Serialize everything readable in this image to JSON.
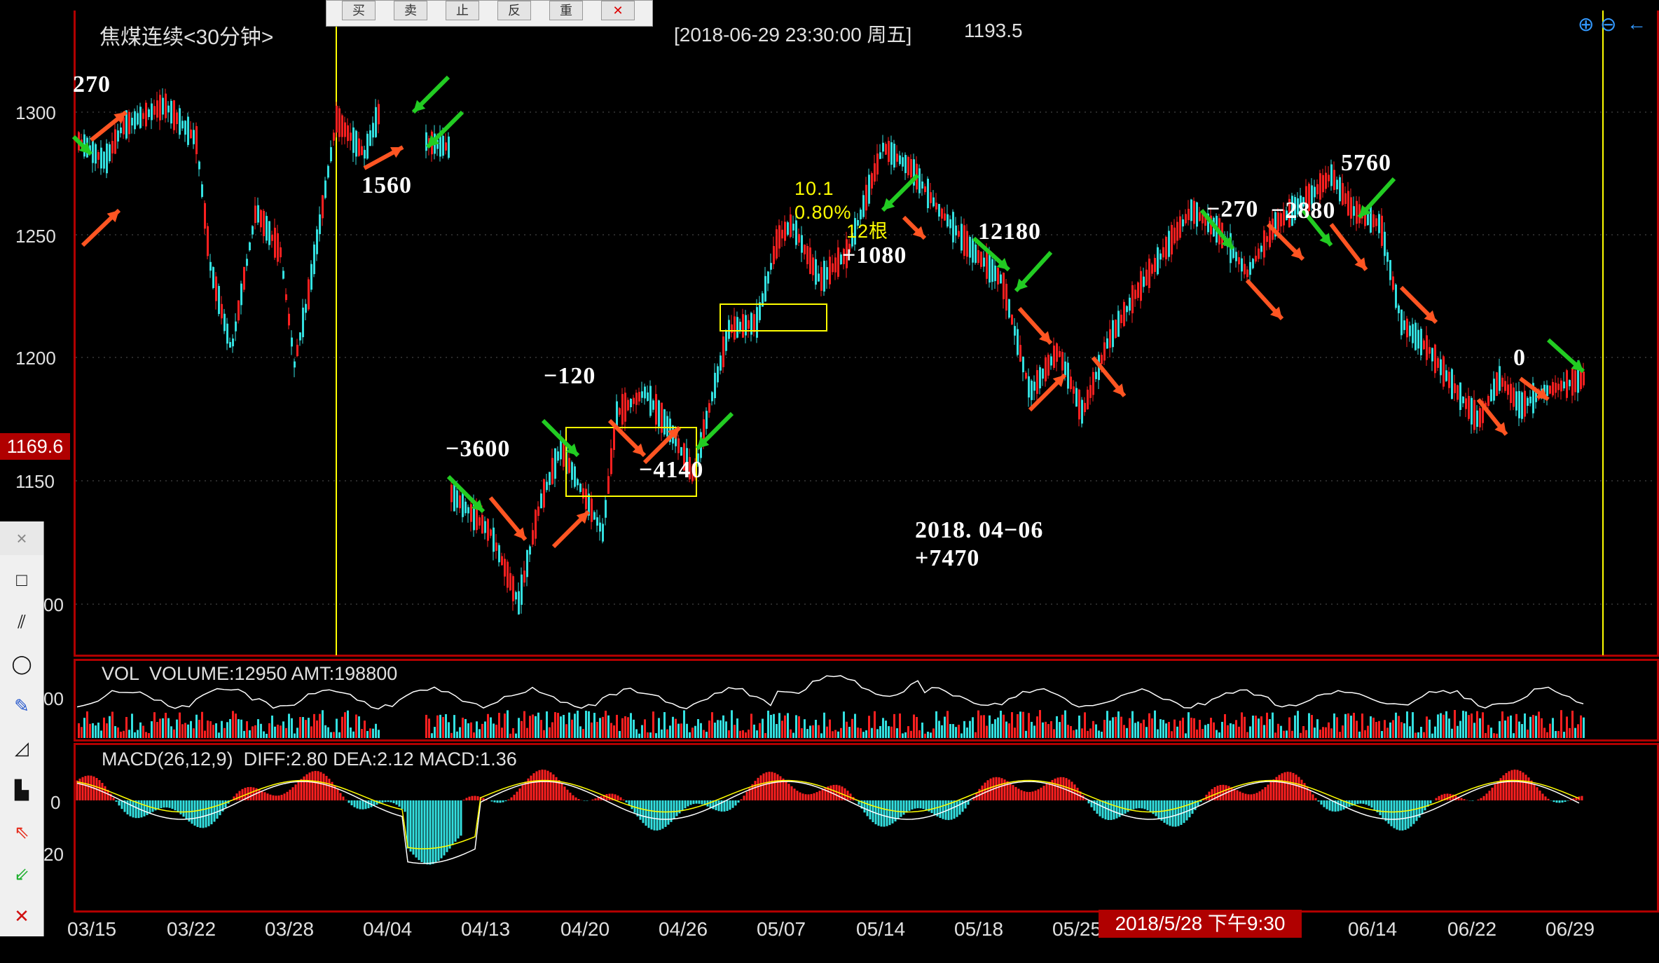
{
  "header": {
    "symbol_title": "焦煤连续<30分钟>",
    "crosshair_time": "[2018-06-29  23:30:00 周五]",
    "crosshair_price": "1193.5"
  },
  "toolbar": {
    "buttons": [
      "买",
      "卖",
      "止",
      "反",
      "重",
      "✕"
    ]
  },
  "draw_tools": {
    "close_label": "×",
    "items": [
      "rectangle-tool",
      "parallel-lines-tool",
      "ellipse-tool",
      "pen-tool",
      "gann-tool",
      "ruler-tool",
      "up-arrow-tool",
      "down-arrow-tool",
      "delete-tool"
    ]
  },
  "price_axis": {
    "ticks": [
      "1300",
      "1250",
      "1200",
      "1150",
      "00"
    ],
    "current_price_tag": "1169.6"
  },
  "vol_axis": {
    "tick": "00"
  },
  "macd_axis": {
    "ticks": [
      "0",
      "20"
    ]
  },
  "date_axis": [
    "03/15",
    "03/22",
    "03/28",
    "04/04",
    "04/13",
    "04/20",
    "04/26",
    "05/07",
    "05/14",
    "05/18",
    "05/25",
    "06/14",
    "06/22",
    "06/29"
  ],
  "crosshair_date": "2018/5/28 下午9:30",
  "indicators": {
    "vol": "VOL  VOLUME:12950 AMT:198800",
    "macd": "MACD(26,12,9)  DIFF:2.80 DEA:2.12 MACD:1.36"
  },
  "annotations": {
    "a270_left": "270",
    "a1560": "1560",
    "a_3600": "−3600",
    "a_120": "−120",
    "a_4140": "−4140",
    "yellow_101": "10.1",
    "yellow_080": "0.80%",
    "yellow_12": "12根",
    "a1080": "+1080",
    "a12180": "12180",
    "a_270": "−270",
    "a_2880": "−2880",
    "a5760": "5760",
    "a0": "0",
    "summary_date": "2018. 04−06",
    "summary_total": "+7470"
  },
  "zoom_icons": [
    "zoom-in-icon",
    "zoom-out-icon",
    "arrow-left-icon"
  ],
  "colors": {
    "up": "#ff2020",
    "down": "#33e0e0",
    "panel_border": "#b00000",
    "buy_arrow": "#22cc22",
    "sell_arrow": "#ff5522",
    "highlight": "#ffff00"
  }
}
